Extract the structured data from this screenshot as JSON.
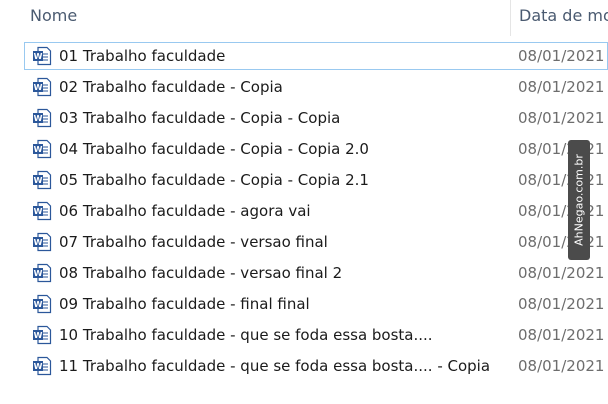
{
  "columns": {
    "name": "Nome",
    "date": "Data de mo"
  },
  "files": [
    {
      "name": "01 Trabalho faculdade",
      "date": "08/01/2021",
      "icon": "word-document-icon"
    },
    {
      "name": "02 Trabalho faculdade - Copia",
      "date": "08/01/2021",
      "icon": "word-document-icon"
    },
    {
      "name": "03 Trabalho faculdade - Copia - Copia",
      "date": "08/01/2021",
      "icon": "word-document-icon"
    },
    {
      "name": "04 Trabalho faculdade - Copia - Copia 2.0",
      "date": "08/01/2021",
      "icon": "word-document-icon"
    },
    {
      "name": "05 Trabalho faculdade - Copia - Copia 2.1",
      "date": "08/01/2021",
      "icon": "word-document-icon"
    },
    {
      "name": "06 Trabalho faculdade - agora vai",
      "date": "08/01/2021",
      "icon": "word-document-icon"
    },
    {
      "name": "07 Trabalho faculdade - versao final",
      "date": "08/01/2021",
      "icon": "word-document-icon"
    },
    {
      "name": "08 Trabalho faculdade - versao final 2",
      "date": "08/01/2021",
      "icon": "word-document-icon"
    },
    {
      "name": "09 Trabalho faculdade - final final",
      "date": "08/01/2021",
      "icon": "word-document-icon"
    },
    {
      "name": "10 Trabalho faculdade - que se foda essa bosta....",
      "date": "08/01/2021",
      "icon": "word-document-icon"
    },
    {
      "name": "11 Trabalho faculdade - que se foda essa bosta.... - Copia",
      "date": "08/01/2021",
      "icon": "word-document-icon"
    }
  ],
  "watermark": "AhNegao.com.br",
  "colors": {
    "word_blue": "#2b579a",
    "focus_border": "#99c9f0"
  }
}
